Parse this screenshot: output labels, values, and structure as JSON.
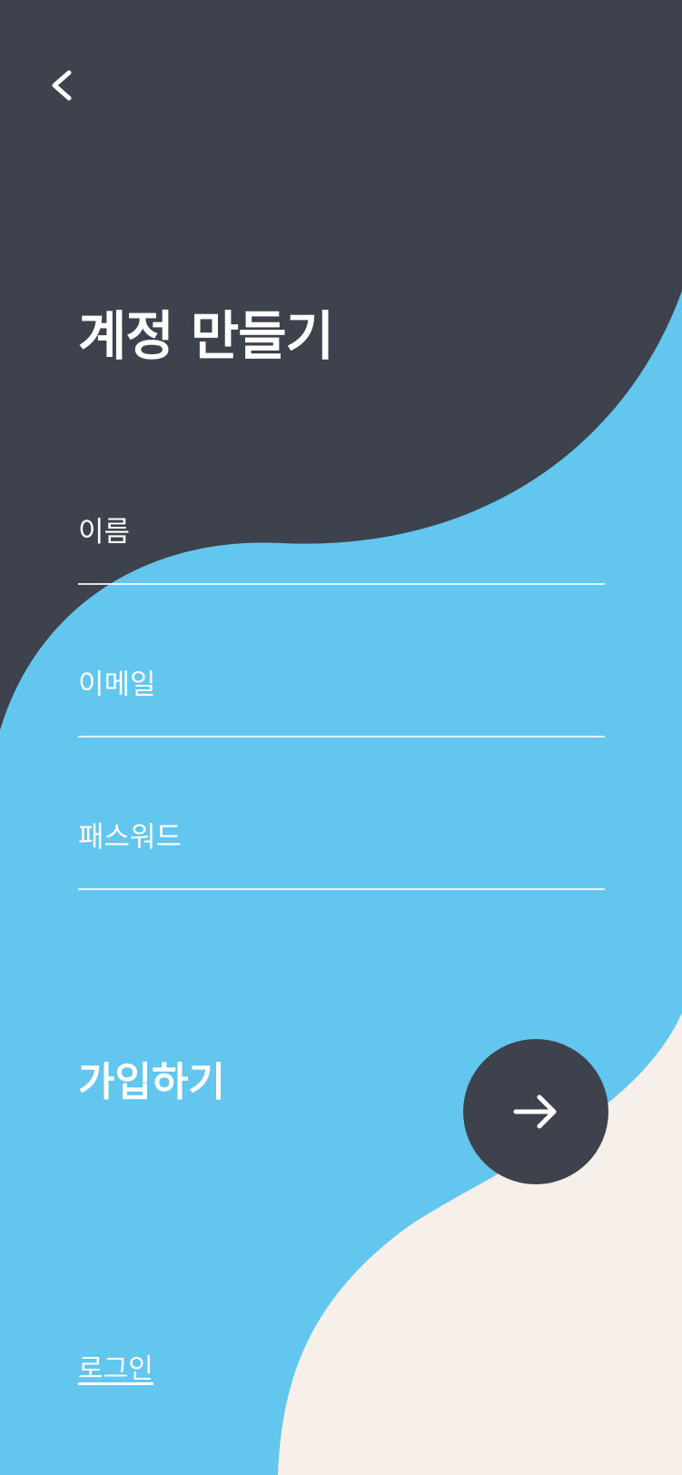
{
  "colors": {
    "dark": "#3E424D",
    "blue": "#62C6EE",
    "cream": "#F7F0EA",
    "text": "#FFFFFF"
  },
  "header": {
    "back_icon": "chevron-left-icon"
  },
  "page": {
    "title": "계정 만들기"
  },
  "form": {
    "name_label": "이름",
    "email_label": "이메일",
    "password_label": "패스워드"
  },
  "actions": {
    "signup_label": "가입하기",
    "submit_icon": "arrow-right-icon",
    "login_link": "로그인"
  }
}
